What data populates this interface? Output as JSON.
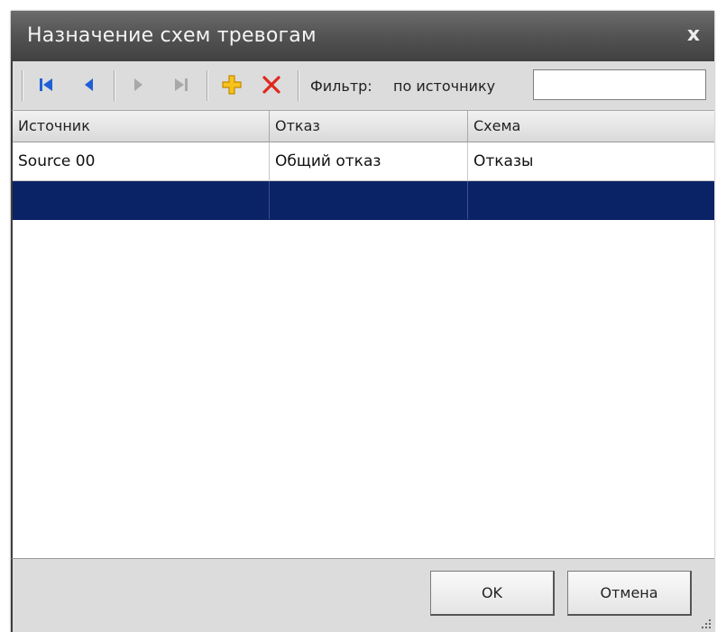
{
  "window": {
    "title": "Назначение схем тревогам",
    "close_glyph": "x"
  },
  "toolbar": {
    "buttons": [
      {
        "name": "first-record-icon",
        "color": "#1f5fd6"
      },
      {
        "name": "prev-record-icon",
        "color": "#1f5fd6"
      },
      {
        "name": "next-record-icon",
        "color": "#9a9a9a"
      },
      {
        "name": "last-record-icon",
        "color": "#9a9a9a"
      },
      {
        "name": "add-record-icon",
        "color": "#f2b400"
      },
      {
        "name": "delete-record-icon",
        "color": "#e0281c"
      }
    ],
    "filter_label": "Фильтр:",
    "filter_mode": "по источнику",
    "filter_value": ""
  },
  "grid": {
    "columns": [
      "Источник",
      "Отказ",
      "Схема"
    ],
    "rows": [
      [
        "Source 00",
        "Общий отказ",
        "Отказы"
      ],
      [
        "",
        "",
        ""
      ]
    ],
    "selected_row": 1,
    "selection_color": "#0a2266"
  },
  "footer": {
    "ok_label": "OK",
    "cancel_label": "Отмена"
  }
}
